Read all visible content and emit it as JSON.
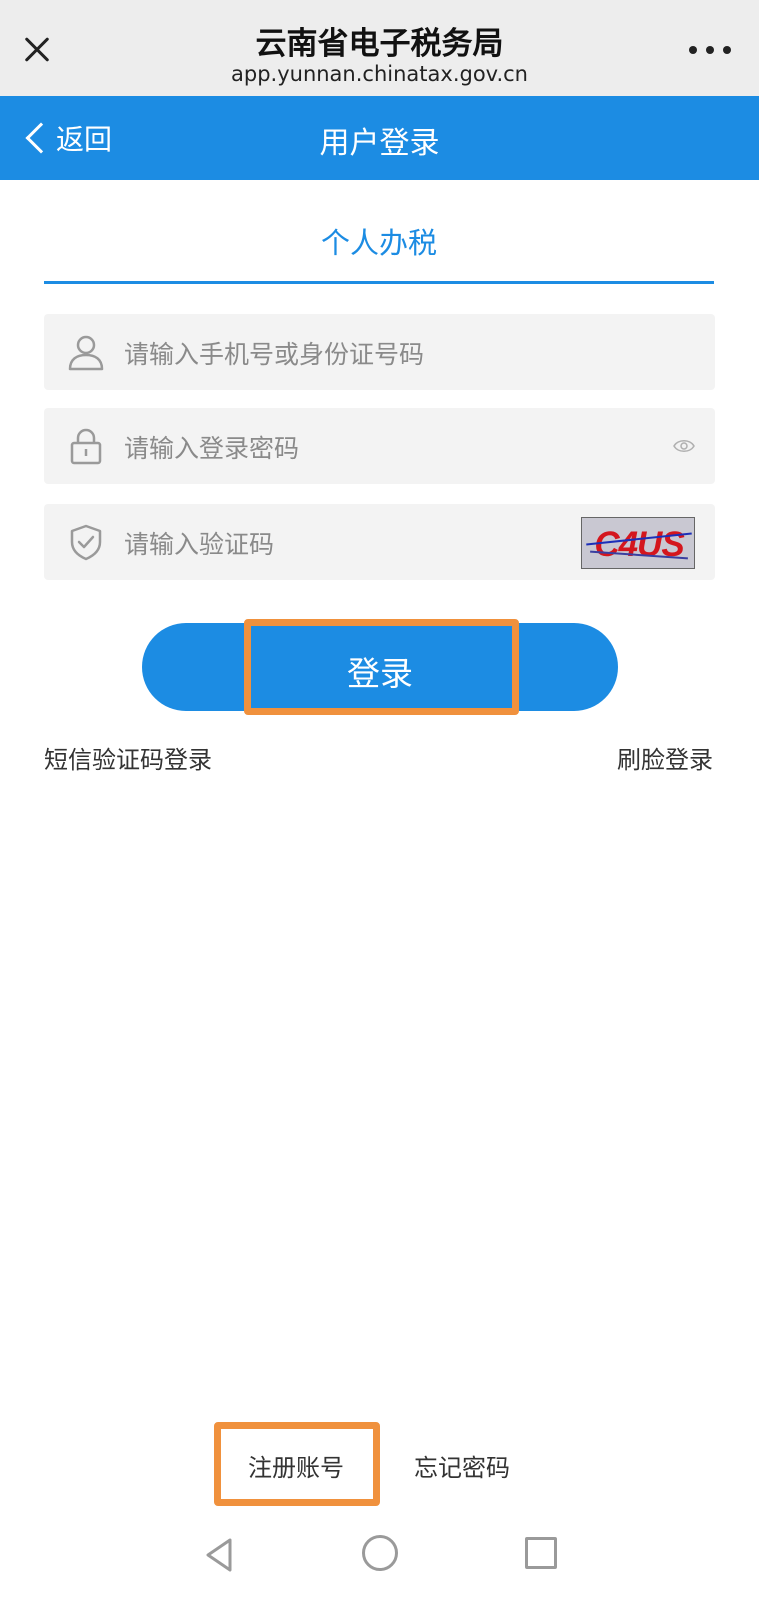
{
  "browser": {
    "title": "云南省电子税务局",
    "url": "app.yunnan.chinatax.gov.cn",
    "close_icon": "close-icon",
    "more_icon": "more-icon"
  },
  "header": {
    "back_label": "返回",
    "title": "用户登录",
    "color": "#1c8ce3"
  },
  "tab": {
    "label": "个人办税"
  },
  "form": {
    "account_placeholder": "请输入手机号或身份证号码",
    "password_placeholder": "请输入登录密码",
    "captcha_placeholder": "请输入验证码",
    "captcha_text": "C4US",
    "login_label": "登录"
  },
  "links": {
    "sms_login": "短信验证码登录",
    "face_login": "刷脸登录",
    "register": "注册账号",
    "forgot_password": "忘记密码"
  },
  "highlight_color": "#f0913d"
}
